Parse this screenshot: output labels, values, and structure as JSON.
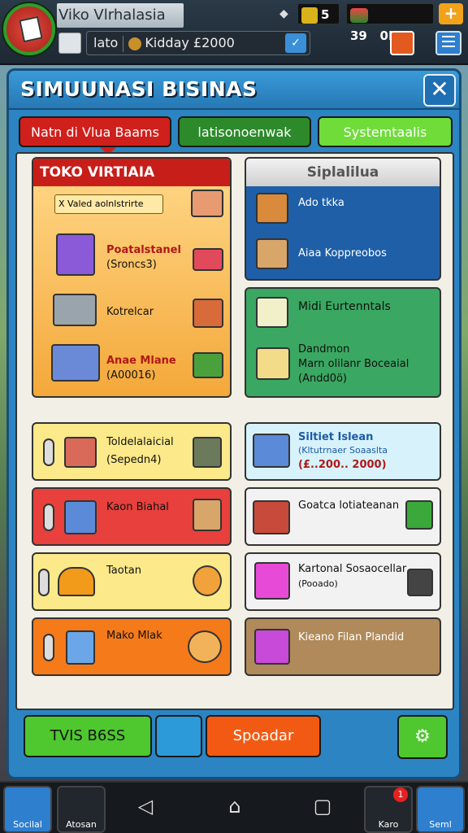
{
  "header": {
    "title": "Viko Vlrhalasia",
    "coins": "5",
    "gems": "39",
    "extra": "0HO",
    "plus": "+",
    "search_left": "lato",
    "search_text": "Kidday £2000"
  },
  "panel": {
    "title": "SIMUUNASI BISINAS",
    "close": "✕",
    "tabs": [
      "Natn di Vlua Baams",
      "latisonoenwak",
      "Systemtaalis"
    ]
  },
  "toko": {
    "title": "TOKO VIRTIAIA",
    "badge": "X Valed aolnlstrirte",
    "items": [
      {
        "name": "Poatalstanel",
        "sub": "(Sroncs3)"
      },
      {
        "name": "Kotrelcar",
        "sub": ""
      },
      {
        "name": "Anae Mlane",
        "sub": "(A00016)"
      }
    ]
  },
  "sipi": {
    "title": "Siplalilua",
    "items": [
      "Ado tkka",
      "Aiaa Koppreobos"
    ]
  },
  "midi": {
    "title": "Midi Eurtenntals",
    "items": [
      "Dandmon",
      "Marn olilanr Boceaial",
      "(Andd0ö)"
    ]
  },
  "left_cards": [
    {
      "name": "Toldelalaicial",
      "sub": "(Sepedn4)"
    },
    {
      "name": "Kaon Biahal",
      "sub": ""
    },
    {
      "name": "Taotan",
      "sub": ""
    },
    {
      "name": "Mako Mlak",
      "sub": ""
    }
  ],
  "right_cards": [
    {
      "name": "Siltiet Islean",
      "sub": "(Kltutrnaer Soaaslta",
      "price": "(£..200.. 2000)"
    },
    {
      "name": "Goatca lotiateanan",
      "sub": ""
    },
    {
      "name": "Kartonal Sosaocellar",
      "sub": "(Pooado)"
    },
    {
      "name": "Kieano Filan Plandid",
      "sub": ""
    }
  ],
  "bottom": {
    "btn_green": "TVIS B6SS",
    "btn_orange": "Spoadar"
  },
  "nav": {
    "left": "Socilal",
    "left2": "Atosan",
    "right1": "Karo",
    "right2": "Seml",
    "notif": "1"
  },
  "colors": {
    "accent": "#2c84c2",
    "red": "#d0201c",
    "green": "#2c8a2a"
  }
}
